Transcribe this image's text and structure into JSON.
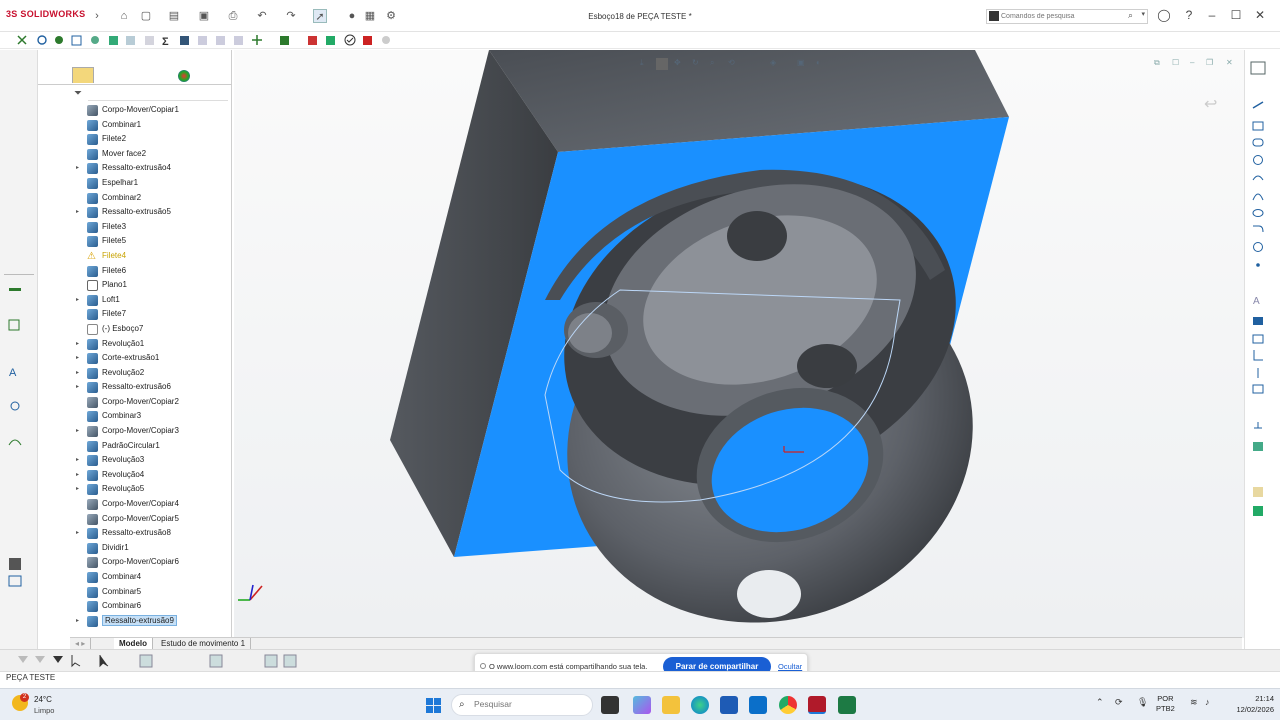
{
  "app": {
    "logo_text": "SOLIDWORKS",
    "logo_prefix": "3S",
    "window_title": "Esboço18 de PEÇA TESTE *"
  },
  "search": {
    "placeholder": "Comandos de pesquisa",
    "value": "Comandos de pesquisa"
  },
  "feature_tree": {
    "items": [
      {
        "label": "Corpo-Mover/Copiar1",
        "icon": "move-copy-icon",
        "expand": false
      },
      {
        "label": "Combinar1",
        "icon": "combine-icon",
        "expand": false
      },
      {
        "label": "Filete2",
        "icon": "fillet-icon",
        "expand": false
      },
      {
        "label": "Mover face2",
        "icon": "move-face-icon",
        "expand": false
      },
      {
        "label": "Ressalto-extrusão4",
        "icon": "boss-extrude-icon",
        "expand": true
      },
      {
        "label": "Espelhar1",
        "icon": "mirror-icon",
        "expand": false
      },
      {
        "label": "Combinar2",
        "icon": "combine-icon",
        "expand": false
      },
      {
        "label": "Ressalto-extrusão5",
        "icon": "boss-extrude-icon",
        "expand": true
      },
      {
        "label": "Filete3",
        "icon": "fillet-icon",
        "expand": false
      },
      {
        "label": "Filete5",
        "icon": "fillet-icon",
        "expand": false
      },
      {
        "label": "Filete4",
        "icon": "fillet-warning-icon",
        "expand": false,
        "warning": true
      },
      {
        "label": "Filete6",
        "icon": "fillet-icon",
        "expand": false
      },
      {
        "label": "Plano1",
        "icon": "plane-icon",
        "expand": false
      },
      {
        "label": "Loft1",
        "icon": "loft-icon",
        "expand": true
      },
      {
        "label": "Filete7",
        "icon": "fillet-icon",
        "expand": false
      },
      {
        "label": "(-) Esboço7",
        "icon": "sketch-icon",
        "expand": false
      },
      {
        "label": "Revolução1",
        "icon": "revolve-icon",
        "expand": true
      },
      {
        "label": "Corte-extrusão1",
        "icon": "cut-extrude-icon",
        "expand": true
      },
      {
        "label": "Revolução2",
        "icon": "revolve-icon",
        "expand": true
      },
      {
        "label": "Ressalto-extrusão6",
        "icon": "boss-extrude-icon",
        "expand": true
      },
      {
        "label": "Corpo-Mover/Copiar2",
        "icon": "move-copy-icon",
        "expand": false
      },
      {
        "label": "Combinar3",
        "icon": "combine-icon",
        "expand": false
      },
      {
        "label": "Corpo-Mover/Copiar3",
        "icon": "move-copy-icon",
        "expand": true
      },
      {
        "label": "PadrãoCircular1",
        "icon": "circular-pattern-icon",
        "expand": false
      },
      {
        "label": "Revolução3",
        "icon": "revolve-icon",
        "expand": true
      },
      {
        "label": "Revolução4",
        "icon": "revolve-icon",
        "expand": true
      },
      {
        "label": "Revolução5",
        "icon": "revolve-icon",
        "expand": true
      },
      {
        "label": "Corpo-Mover/Copiar4",
        "icon": "move-copy-icon",
        "expand": false
      },
      {
        "label": "Corpo-Mover/Copiar5",
        "icon": "move-copy-icon",
        "expand": false
      },
      {
        "label": "Ressalto-extrusão8",
        "icon": "boss-extrude-icon",
        "expand": true
      },
      {
        "label": "Dividir1",
        "icon": "split-icon",
        "expand": false
      },
      {
        "label": "Corpo-Mover/Copiar6",
        "icon": "move-copy-icon",
        "expand": false
      },
      {
        "label": "Combinar4",
        "icon": "combine-icon",
        "expand": false
      },
      {
        "label": "Combinar5",
        "icon": "combine-icon",
        "expand": false
      },
      {
        "label": "Combinar6",
        "icon": "combine-icon",
        "expand": false
      },
      {
        "label": "Ressalto-extrusão9",
        "icon": "boss-extrude-icon",
        "expand": true,
        "selected": true
      }
    ]
  },
  "bottom_tabs": {
    "model": "Modelo",
    "motion": "Estudo de movimento 1"
  },
  "loom": {
    "message": "O www.loom.com está compartilhando sua tela.",
    "stop_button": "Parar de compartilhar",
    "hide_link": "Ocultar"
  },
  "status": {
    "document_name": "PEÇA TESTE"
  },
  "taskbar": {
    "weather_temp": "24°C",
    "weather_cond": "Limpo",
    "notification_count": "2",
    "search_placeholder": "Pesquisar",
    "lang_line1": "POR",
    "lang_line2": "PTB2",
    "time": "21:14",
    "date": "12/02/2026"
  },
  "colors": {
    "accent": "#1a5fd4",
    "sketch_plane": "#1a90ff",
    "part_grey": "#5d6168",
    "brand_red": "#c8102e"
  }
}
